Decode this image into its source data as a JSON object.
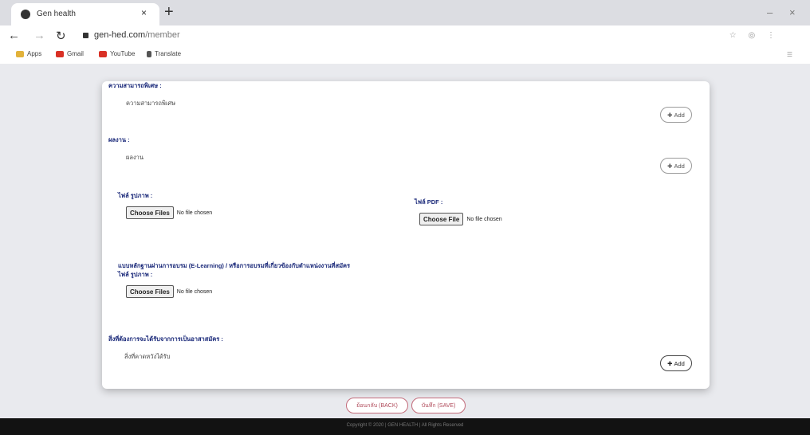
{
  "browser": {
    "tab_title": "Gen health",
    "tab_close": "×",
    "new_tab": "+",
    "window_controls": {
      "minimize": "–",
      "close": "×"
    },
    "url_host": "gen-hed.com",
    "url_path": "/member",
    "bookmarks": [
      {
        "label": "Apps",
        "color": "#e2b23a"
      },
      {
        "label": "Gmail",
        "color": "#d93025"
      },
      {
        "label": "YouTube",
        "color": "#d93025"
      },
      {
        "label": "Translate",
        "color": "#555555"
      }
    ]
  },
  "form": {
    "section1": {
      "label": "ความสามารถพิเศษ :",
      "value": "ความสามารถพิเศษ",
      "add_label": "Add"
    },
    "section2": {
      "label": "ผลงาน :",
      "value": "ผลงาน",
      "add_label": "Add"
    },
    "upload_image": {
      "label": "ไฟล์ รูปภาพ :",
      "button": "Choose Files",
      "status": "No file chosen"
    },
    "upload_pdf": {
      "label": "ไฟล์ PDF :",
      "button": "Choose File",
      "status": "No file chosen"
    },
    "elearning": {
      "label": "แบบหลักฐานผ่านการอบรม (E-Learning) / หรือการอบรมที่เกี่ยวข้องกับตำแหน่งงานที่สมัคร",
      "sublabel": "ไฟล์ รูปภาพ :",
      "button": "Choose Files",
      "status": "No file chosen"
    },
    "section4": {
      "label": "สิ่งที่ต้องการจะได้รับจากการเป็นอาสาสมัคร :",
      "value": "สิ่งที่คาดหวังได้รับ",
      "add_label": "Add"
    }
  },
  "actions": {
    "back_label": "ย้อนกลับ (BACK)",
    "save_label": "บันทึก (SAVE)"
  },
  "footer": {
    "copyright": "Copyright © 2020 | GEN HEALTH | All Rights Reserved"
  },
  "colors": {
    "label_blue": "#1b2a7a",
    "button_red": "#b04a5a",
    "footer_bg": "#121212"
  }
}
